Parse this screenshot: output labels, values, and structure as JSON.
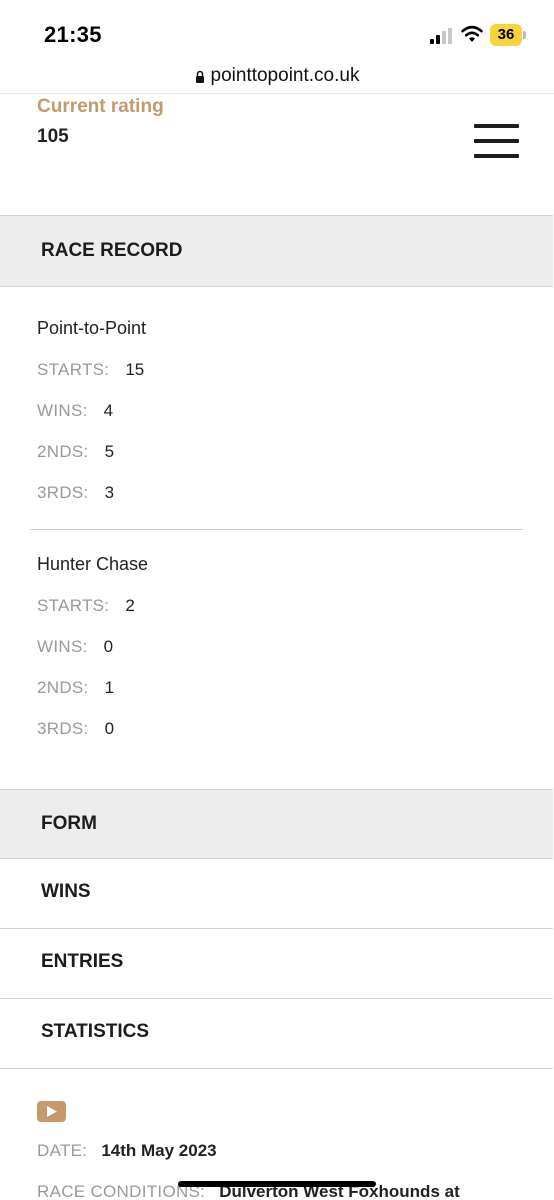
{
  "status_bar": {
    "time": "21:35",
    "battery": "36",
    "battery_color": "#f7d33c",
    "icons": [
      "signal-icon",
      "wifi-icon",
      "battery-icon"
    ]
  },
  "browser": {
    "url": "pointtopoint.co.uk",
    "icons": [
      "lock-icon"
    ]
  },
  "header": {
    "rating_label": "Current rating",
    "rating_value": "105",
    "menu_icon": "hamburger-menu-icon"
  },
  "race_record": {
    "title": "RACE RECORD",
    "groups": [
      {
        "title": "Point-to-Point",
        "stats": [
          {
            "key": "STARTS:",
            "value": "15"
          },
          {
            "key": "WINS:",
            "value": "4"
          },
          {
            "key": "2NDS:",
            "value": "5"
          },
          {
            "key": "3RDS:",
            "value": "3"
          }
        ]
      },
      {
        "title": "Hunter Chase",
        "stats": [
          {
            "key": "STARTS:",
            "value": "2"
          },
          {
            "key": "WINS:",
            "value": "0"
          },
          {
            "key": "2NDS:",
            "value": "1"
          },
          {
            "key": "3RDS:",
            "value": "0"
          }
        ]
      }
    ]
  },
  "sections": {
    "form": "FORM",
    "wins": "WINS",
    "entries": "ENTRIES",
    "statistics": "STATISTICS"
  },
  "form_entry": {
    "video_icon": "play-video-icon",
    "date_label": "DATE:",
    "date_value": "14th May 2023",
    "conditions_label": "RACE CONDITIONS:",
    "conditions_value": "Dulverton West Foxhounds at"
  },
  "colors": {
    "accent": "#c49a6c",
    "section_bg": "#ededed",
    "muted_label": "#9a9a9a"
  }
}
